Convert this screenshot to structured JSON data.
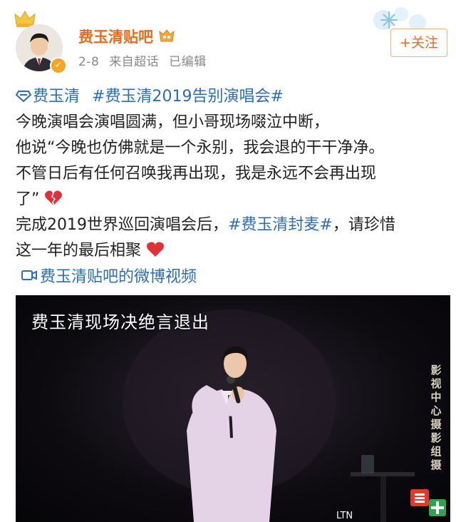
{
  "post_header": {
    "username": "费玉清贴吧",
    "date": "2-8",
    "source": "来自超话",
    "edited": "已编辑",
    "follow_label": "+关注"
  },
  "post_body": {
    "topic_1": "费玉清",
    "topic_2": "#费玉清2019告别演唱会#",
    "line_2": "今晚演唱会演唱圆满，但小哥现场啜泣中断，",
    "line_3": "他说“今晚也仿佛就是一个永别，我会退的干干净净。",
    "line_4": "不管日后有任何召唤我再出现，我是永远不会再出现",
    "line_5": "了”",
    "line_6_prefix": "完成2019世界巡回演唱会后，",
    "line_6_topic": "#费玉清封麦#",
    "line_6_suffix": "，请珍惜",
    "line_7": "这一年的最后相聚",
    "video_link": "费玉清贴吧的微博视频"
  },
  "video": {
    "caption": "费玉清现场决绝言退出",
    "watermark": "影视中心摄影组摄",
    "channel_logo": "LTN"
  },
  "icons": {
    "crown": "crown-icon",
    "verified": "verified-badge-icon",
    "vip": "vip-badge-icon",
    "topic": "super-topic-diamond-icon",
    "broken_heart": "broken-heart-emoji",
    "heart": "red-heart-emoji",
    "video": "video-camera-icon"
  },
  "colors": {
    "username": "#e86b1f",
    "link": "#2b6eb5",
    "meta": "#888888"
  }
}
